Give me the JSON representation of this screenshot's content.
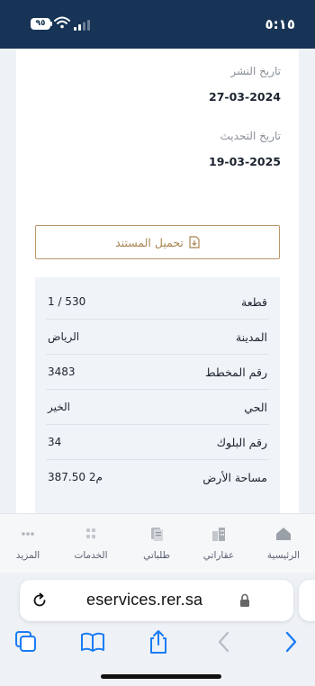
{
  "status_bar": {
    "time": "٥:١٥",
    "battery": "٩٥"
  },
  "document": {
    "publish_date_label": "تاريخ النشر",
    "publish_date": "27-03-2024",
    "update_date_label": "تاريخ التحديث",
    "update_date": "19-03-2025",
    "download_label": "تحميل المستند"
  },
  "details": [
    {
      "label": "قطعة",
      "value": "1 / 530"
    },
    {
      "label": "المدينة",
      "value": "الرياض"
    },
    {
      "label": "رقم المخطط",
      "value": "3483"
    },
    {
      "label": "الحي",
      "value": "الخير"
    },
    {
      "label": "رقم البلوك",
      "value": "34"
    },
    {
      "label": "مساحة الأرض",
      "value": "387.50 م2"
    }
  ],
  "bottom_nav": [
    {
      "label": "الرئيسية",
      "icon": "home-icon"
    },
    {
      "label": "عقاراتي",
      "icon": "buildings-icon"
    },
    {
      "label": "طلباتي",
      "icon": "requests-icon"
    },
    {
      "label": "الخدمات",
      "icon": "services-grid-icon"
    },
    {
      "label": "المزيد",
      "icon": "more-dots-icon"
    }
  ],
  "browser": {
    "url": "eservices.rer.sa"
  },
  "colors": {
    "status_bar_bg": "#173456",
    "accent_gold": "#b9976a",
    "safari_blue": "#1a7cf5"
  }
}
